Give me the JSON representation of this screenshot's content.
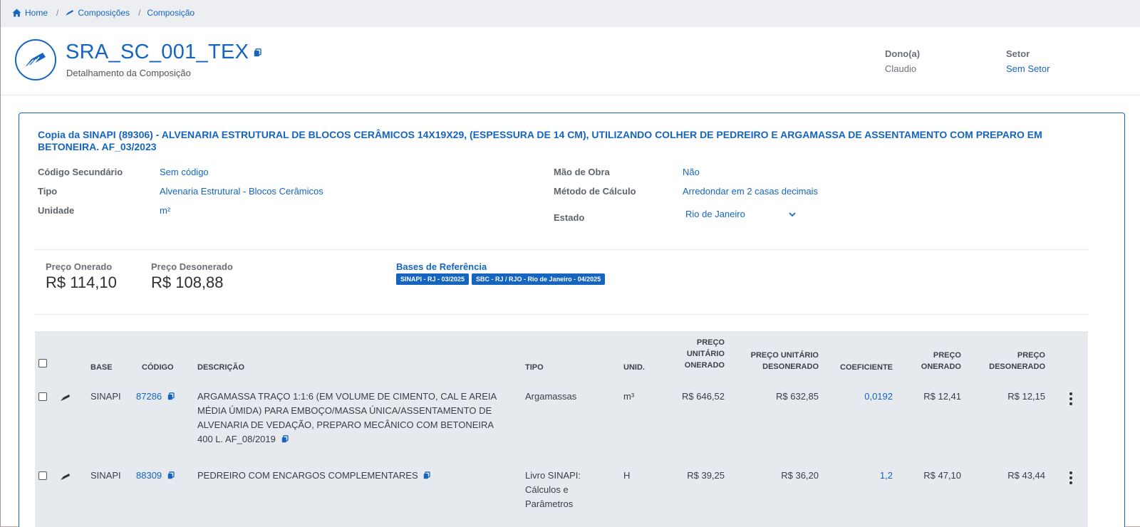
{
  "breadcrumb": {
    "home": "Home",
    "compositions": "Composições",
    "composition": "Composição"
  },
  "header": {
    "title": "SRA_SC_001_TEX",
    "subtitle": "Detalhamento da Composição",
    "owner_label": "Dono(a)",
    "owner_value": "Claudio",
    "sector_label": "Setor",
    "sector_value": "Sem Setor"
  },
  "composition": {
    "full_title": "Copia da SINAPI (89306) - ALVENARIA ESTRUTURAL DE BLOCOS CERÂMICOS 14X19X29, (ESPESSURA DE 14 CM), UTILIZANDO COLHER DE PEDREIRO E ARGAMASSA DE ASSENTAMENTO COM PREPARO EM BETONEIRA. AF_03/2023",
    "fields": {
      "secondary_code_label": "Código Secundário",
      "secondary_code_value": "Sem código",
      "type_label": "Tipo",
      "type_value": "Alvenaria Estrutural - Blocos Cerâmicos",
      "unit_label": "Unidade",
      "unit_value": "m²",
      "labor_label": "Mão de Obra",
      "labor_value": "Não",
      "calc_label": "Método de Cálculo",
      "calc_value": "Arredondar em 2 casas decimais",
      "state_label": "Estado",
      "state_value": "Rio de Janeiro"
    },
    "prices": {
      "onerado_label": "Preço Onerado",
      "onerado_value": "R$ 114,10",
      "desonerado_label": "Preço Desonerado",
      "desonerado_value": "R$ 108,88"
    },
    "bases": {
      "label": "Bases de Referência",
      "items": [
        "SINAPI - RJ - 03/2025",
        "SBC - RJ / RJO - Rio de Janeiro - 04/2025"
      ]
    }
  },
  "table": {
    "headers": {
      "base": "BASE",
      "code": "CÓDIGO",
      "description": "DESCRIÇÃO",
      "type": "TIPO",
      "unit": "UNID.",
      "unit_price_onerado": "PREÇO UNITÁRIO ONERADO",
      "unit_price_desonerado": "PREÇO UNITÁRIO DESONERADO",
      "coefficient": "COEFICIENTE",
      "price_onerado": "PREÇO ONERADO",
      "price_desonerado": "PREÇO DESONERADO"
    },
    "rows": [
      {
        "base": "SINAPI",
        "code": "87286",
        "description": "ARGAMASSA TRAÇO 1:1:6 (EM VOLUME DE CIMENTO, CAL E AREIA MÉDIA ÚMIDA) PARA EMBOÇO/MASSA ÚNICA/ASSENTAMENTO DE ALVENARIA DE VEDAÇÃO, PREPARO MECÂNICO COM BETONEIRA 400 L. AF_08/2019",
        "type": "Argamassas",
        "unit": "m³",
        "unit_price_onerado": "R$ 646,52",
        "unit_price_desonerado": "R$ 632,85",
        "coefficient": "0,0192",
        "price_onerado": "R$ 12,41",
        "price_desonerado": "R$ 12,15"
      },
      {
        "base": "SINAPI",
        "code": "88309",
        "description": "PEDREIRO COM ENCARGOS COMPLEMENTARES",
        "type": "Livro SINAPI: Cálculos e Parâmetros",
        "unit": "H",
        "unit_price_onerado": "R$ 39,25",
        "unit_price_desonerado": "R$ 36,20",
        "coefficient": "1,2",
        "price_onerado": "R$ 47,10",
        "price_desonerado": "R$ 43,44"
      }
    ]
  },
  "colors": {
    "primary": "#1565c0",
    "topbar_bg": "#eceef2",
    "table_bg": "#e6e9ee"
  },
  "icons": [
    "home-icon",
    "trowel-icon",
    "copy-icon",
    "chevron-down-icon",
    "kebab-menu-icon"
  ]
}
